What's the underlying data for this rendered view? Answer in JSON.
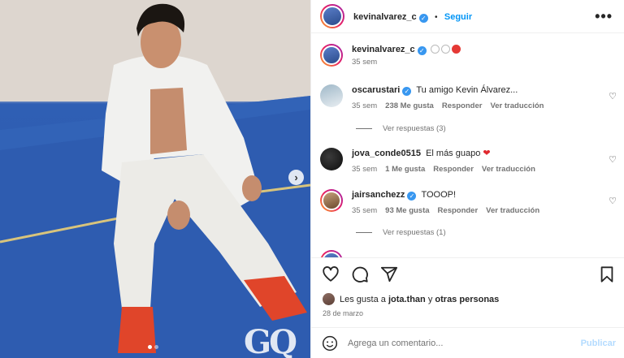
{
  "header": {
    "username": "kevinalvarez_c",
    "separator": "•",
    "follow_label": "Seguir",
    "more_label": "•••"
  },
  "photo": {
    "watermark": "GQ"
  },
  "caption": {
    "username": "kevinalvarez_c",
    "time": "35 sem"
  },
  "comments": [
    {
      "username": "oscarustari",
      "verified": true,
      "text": "Tu amigo Kevin Álvarez...",
      "time": "35 sem",
      "likes": "238 Me gusta",
      "reply_label": "Responder",
      "translate_label": "Ver traducción",
      "replies_label": "Ver respuestas (3)"
    },
    {
      "username": "jova_conde0515",
      "verified": false,
      "text": "El más guapo",
      "time": "35 sem",
      "likes": "1 Me gusta",
      "reply_label": "Responder",
      "translate_label": "Ver traducción"
    },
    {
      "username": "jairsanchezz",
      "verified": true,
      "text": "TOOOP!",
      "time": "35 sem",
      "likes": "93 Me gusta",
      "reply_label": "Responder",
      "translate_label": "Ver traducción",
      "replies_label": "Ver respuestas (1)"
    }
  ],
  "likes_summary": {
    "prefix": "Les gusta a",
    "user": "jota.than",
    "connector": "y",
    "others": "otras personas"
  },
  "post_date": "28 de marzo",
  "comment_box": {
    "placeholder": "Agrega un comentario...",
    "publish_label": "Publicar"
  },
  "icons": [
    "heart-icon",
    "comment-icon",
    "share-icon",
    "bookmark-icon",
    "emoji-icon",
    "more-icon",
    "verified-badge-icon",
    "chevron-right-icon"
  ]
}
